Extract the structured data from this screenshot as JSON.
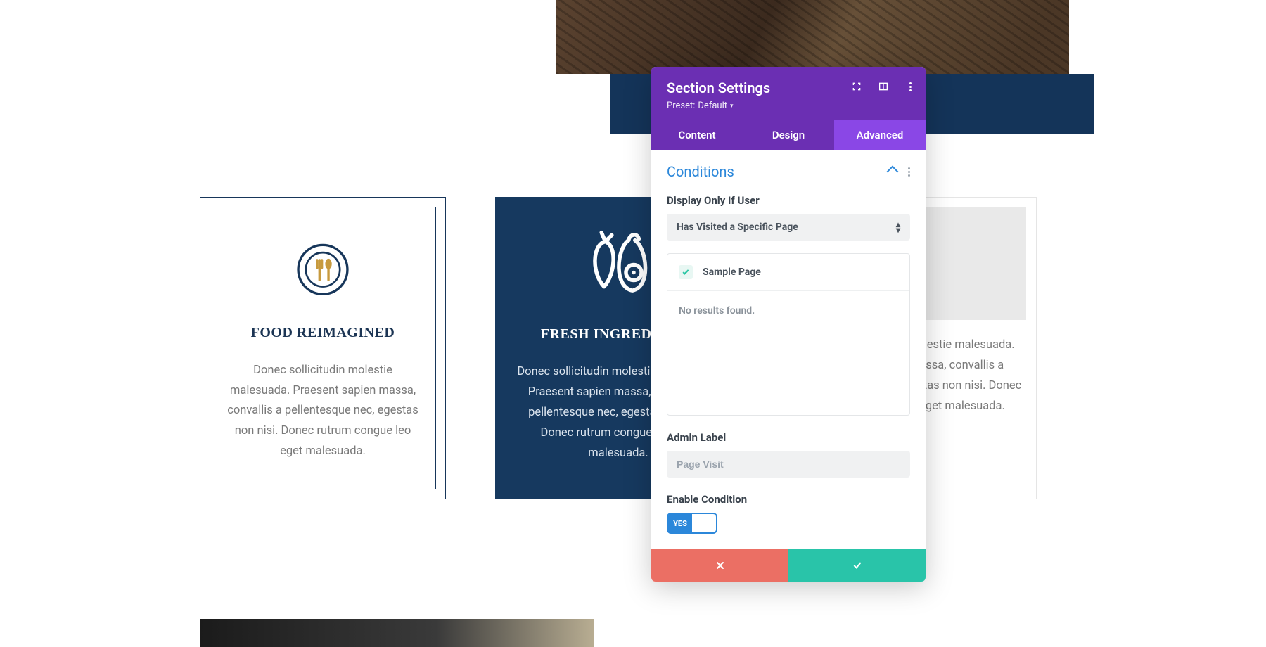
{
  "cards": [
    {
      "title": "FOOD REIMAGINED",
      "body": "Donec sollicitudin molestie malesuada. Praesent sapien massa, convallis a pellentesque nec, egestas non nisi. Donec rutrum congue leo eget malesuada."
    },
    {
      "title": "FRESH INGREDIENTS",
      "body": "Donec sollicitudin molestie malesuada. Praesent sapien massa, convallis a pellentesque nec, egestas non nisi. Donec rutrum congue leo eget malesuada."
    },
    {
      "title": "",
      "body": "Donec sollicitudin molestie malesuada. Praesent sapien massa, convallis a pellentesque nec, egestas non nisi. Donec rutrum congue leo eget malesuada."
    }
  ],
  "modal": {
    "title": "Section Settings",
    "preset_prefix": "Preset: ",
    "preset_value": "Default",
    "tabs": {
      "content": "Content",
      "design": "Design",
      "advanced": "Advanced"
    },
    "section": "Conditions",
    "display_label": "Display Only If User",
    "display_select": "Has Visited a Specific Page",
    "selected_page": "Sample Page",
    "no_results": "No results found.",
    "admin_label": "Admin Label",
    "admin_value": "Page Visit",
    "enable_label": "Enable Condition",
    "toggle_text": "YES"
  }
}
